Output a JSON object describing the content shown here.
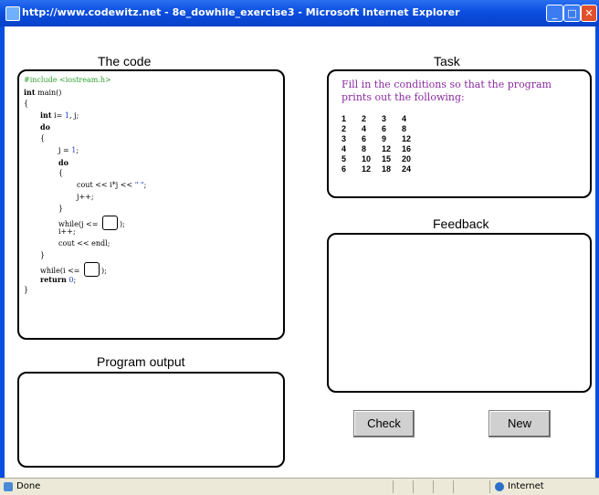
{
  "window": {
    "title": "http://www.codewitz.net - 8e_dowhile_exercise3 - Microsoft Internet Explorer"
  },
  "headings": {
    "code": "The code",
    "task": "Task",
    "output": "Program output",
    "feedback": "Feedback"
  },
  "code": {
    "include": "#include <iostream.h>",
    "int_kw": "int",
    "main_rest": " main()",
    "brace_open": "{",
    "decl_kw": "int",
    "decl_a": " i= ",
    "decl_num": "1",
    "decl_b": ", j;",
    "do_kw": "do",
    "inner_brace_open": "{",
    "assign_a": "j = ",
    "assign_num": "1",
    "assign_b": ";",
    "inner_do": "do",
    "innermost_open": "{",
    "cout_a": "cout << i*j << ",
    "cout_str": "\" \"",
    "cout_b": ";",
    "jinc": "j++;",
    "innermost_close": "}",
    "while_j_a": "while(j <= ",
    "while_j_b": ");",
    "iinc": "i++;",
    "endl": "cout << endl;",
    "inner_brace_close": "}",
    "while_i_a": "while(i <= ",
    "while_i_b": ");",
    "return_kw": "return",
    "return_num": "0",
    "return_b": ";",
    "brace_close": "}"
  },
  "task": {
    "text": "Fill in the conditions so that the program prints out the following:",
    "table": [
      [
        "1",
        "2",
        "3",
        "4"
      ],
      [
        "2",
        "4",
        "6",
        "8"
      ],
      [
        "3",
        "6",
        "9",
        "12"
      ],
      [
        "4",
        "8",
        "12",
        "16"
      ],
      [
        "5",
        "10",
        "15",
        "20"
      ],
      [
        "6",
        "12",
        "18",
        "24"
      ]
    ]
  },
  "buttons": {
    "check": "Check",
    "new": "New"
  },
  "status": {
    "left": "Done",
    "zone": "Internet"
  }
}
